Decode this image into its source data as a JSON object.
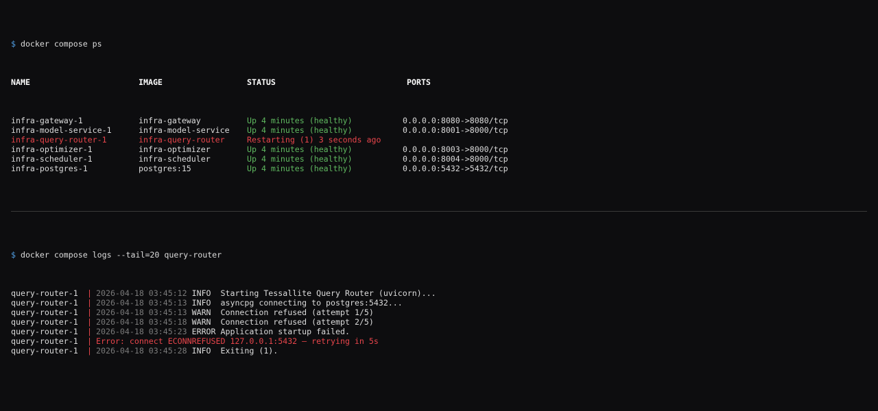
{
  "ps": {
    "prompt": "$",
    "command": "docker compose ps",
    "headers": {
      "name": "NAME",
      "image": "IMAGE",
      "status": "STATUS",
      "ports": "PORTS"
    },
    "rows": [
      {
        "name": "infra-gateway-1",
        "image": "infra-gateway",
        "status": "Up 4 minutes (healthy)",
        "ports": "0.0.0.0:8080->8080/tcp",
        "state": "healthy"
      },
      {
        "name": "infra-model-service-1",
        "image": "infra-model-service",
        "status": "Up 4 minutes (healthy)",
        "ports": "0.0.0.0:8001->8000/tcp",
        "state": "healthy"
      },
      {
        "name": "infra-query-router-1",
        "image": "infra-query-router",
        "status": "Restarting (1) 3 seconds ago",
        "ports": "",
        "state": "error"
      },
      {
        "name": "infra-optimizer-1",
        "image": "infra-optimizer",
        "status": "Up 4 minutes (healthy)",
        "ports": "0.0.0.0:8003->8000/tcp",
        "state": "healthy"
      },
      {
        "name": "infra-scheduler-1",
        "image": "infra-scheduler",
        "status": "Up 4 minutes (healthy)",
        "ports": "0.0.0.0:8004->8000/tcp",
        "state": "healthy"
      },
      {
        "name": "infra-postgres-1",
        "image": "postgres:15",
        "status": "Up 4 minutes (healthy)",
        "ports": "0.0.0.0:5432->5432/tcp",
        "state": "healthy"
      }
    ]
  },
  "logs": {
    "prompt": "$",
    "command": "docker compose logs --tail=20 query-router",
    "separator": "|",
    "lines": [
      {
        "source": "query-router-1",
        "timestamp": "2026-04-18 03:45:12",
        "level": "INFO ",
        "message": "Starting Tessallite Query Router (uvicorn)...",
        "kind": "normal"
      },
      {
        "source": "query-router-1",
        "timestamp": "2026-04-18 03:45:13",
        "level": "INFO ",
        "message": "asyncpg connecting to postgres:5432...",
        "kind": "normal"
      },
      {
        "source": "query-router-1",
        "timestamp": "2026-04-18 03:45:13",
        "level": "WARN ",
        "message": "Connection refused (attempt 1/5)",
        "kind": "normal"
      },
      {
        "source": "query-router-1",
        "timestamp": "2026-04-18 03:45:18",
        "level": "WARN ",
        "message": "Connection refused (attempt 2/5)",
        "kind": "normal"
      },
      {
        "source": "query-router-1",
        "timestamp": "2026-04-18 03:45:23",
        "level": "ERROR",
        "message": "Application startup failed.",
        "kind": "normal"
      },
      {
        "source": "query-router-1",
        "timestamp": "",
        "level": "",
        "message": "Error: connect ECONNREFUSED 127.0.0.1:5432 — retrying in 5s",
        "kind": "error"
      },
      {
        "source": "query-router-1",
        "timestamp": "2026-04-18 03:45:28",
        "level": "INFO ",
        "message": "Exiting (1).",
        "kind": "normal"
      }
    ]
  },
  "colors": {
    "prompt": "#4f9ce0",
    "healthy": "#5fb85f",
    "error": "#e8454b",
    "timestamp": "#7a7a7a"
  }
}
